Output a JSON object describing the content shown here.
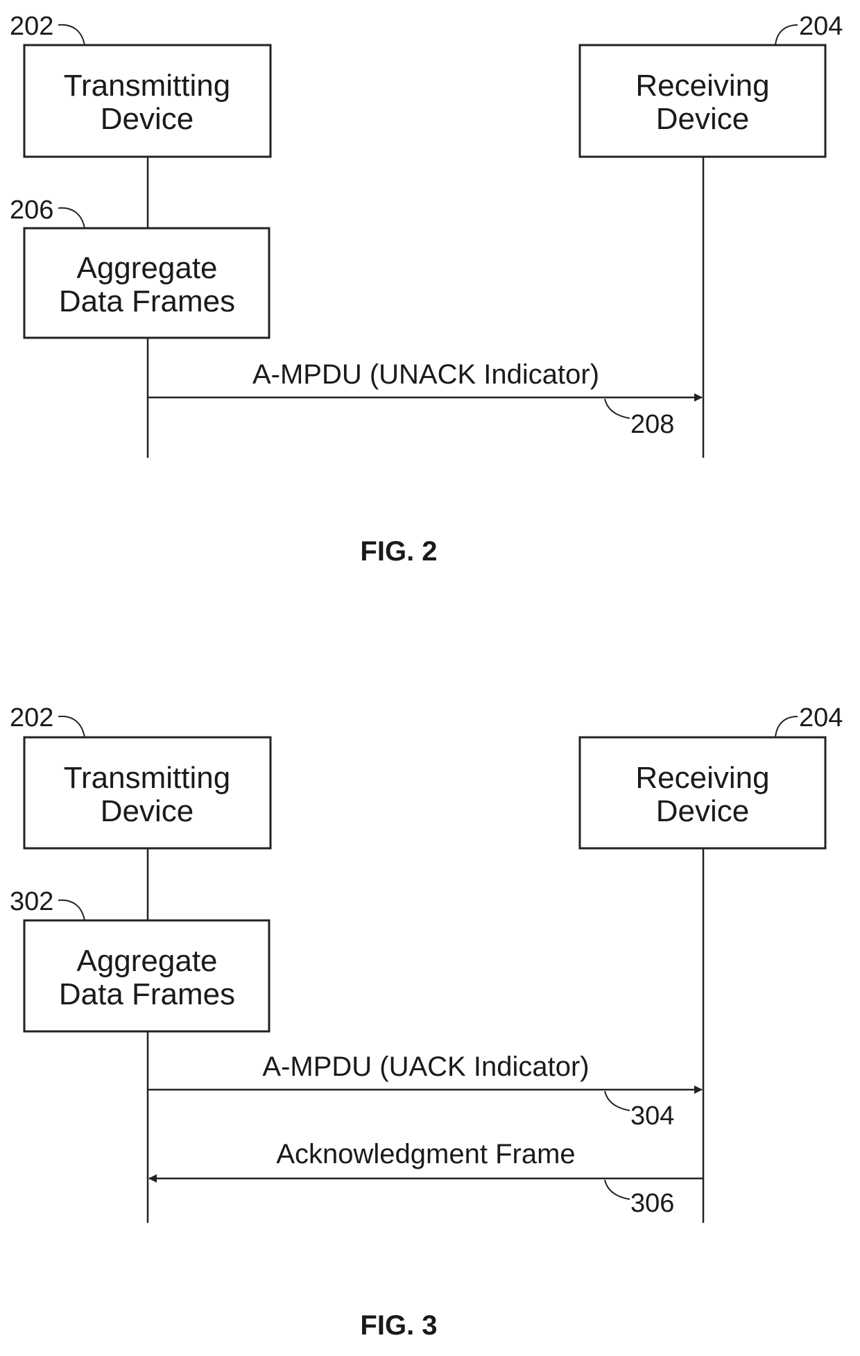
{
  "figures": [
    {
      "caption": "FIG. 2",
      "participants": [
        {
          "ref": "202",
          "line1": "Transmitting",
          "line2": "Device"
        },
        {
          "ref": "204",
          "line1": "Receiving",
          "line2": "Device"
        }
      ],
      "process": {
        "ref": "206",
        "line1": "Aggregate",
        "line2": "Data Frames"
      },
      "messages": [
        {
          "ref": "208",
          "label": "A-MPDU (UNACK Indicator)",
          "direction": "to-receiver"
        }
      ]
    },
    {
      "caption": "FIG. 3",
      "participants": [
        {
          "ref": "202",
          "line1": "Transmitting",
          "line2": "Device"
        },
        {
          "ref": "204",
          "line1": "Receiving",
          "line2": "Device"
        }
      ],
      "process": {
        "ref": "302",
        "line1": "Aggregate",
        "line2": "Data Frames"
      },
      "messages": [
        {
          "ref": "304",
          "label": "A-MPDU (UACK Indicator)",
          "direction": "to-receiver"
        },
        {
          "ref": "306",
          "label": "Acknowledgment Frame",
          "direction": "to-transmitter"
        }
      ]
    }
  ]
}
